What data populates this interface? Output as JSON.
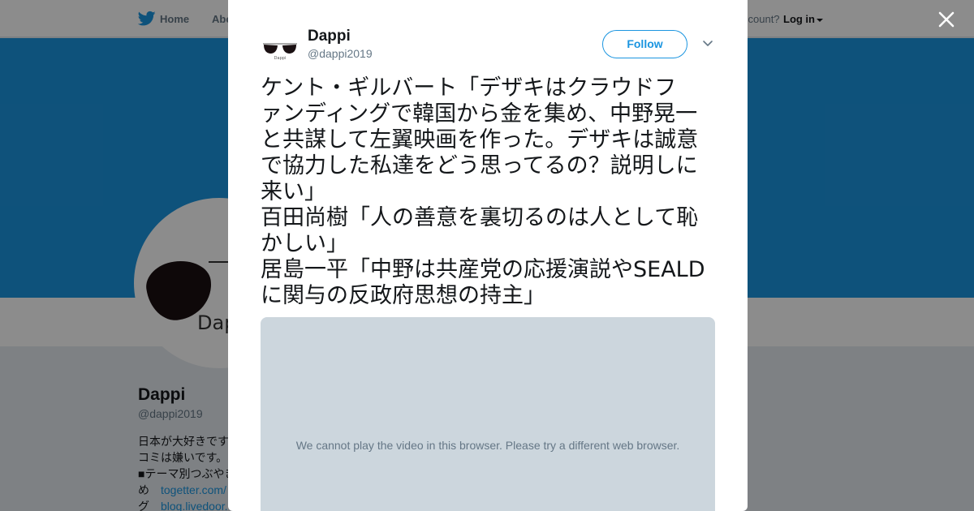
{
  "background_page": {
    "nav": {
      "home_label": "Home",
      "about_label": "Abo",
      "account_text": "ccount?",
      "login_label": "Log in"
    },
    "profile": {
      "avatar_text": "Dap",
      "name": "Dappi",
      "handle": "@dappi2019",
      "bio_lines": [
        {
          "prefix": "日本が大好きです",
          "link": ""
        },
        {
          "prefix": "コミは嫌いです。",
          "link": ""
        },
        {
          "prefix": "■テーマ別つぶやき",
          "link": ""
        },
        {
          "prefix": "め",
          "link": "togetter.com/"
        },
        {
          "prefix": "グ",
          "link": "blog.livedoor."
        }
      ]
    }
  },
  "modal": {
    "author": {
      "name": "Dappi",
      "handle": "@dappi2019",
      "avatar_text": "Dappi"
    },
    "follow_label": "Follow",
    "tweet_lines": [
      "ケント・ギルバート「デザキはクラウドフ",
      "ァンディングで韓国から金を集め、中野晃一",
      "と共謀して左翼映画を作った。デザキは誠意",
      "で協力した私達をどう思ってるの？説明しに",
      "来い」",
      "百田尚樹「人の善意を裏切るのは人として恥",
      "かしい」",
      "居島一平「中野は共産党の応援演説やSEALD",
      "に関与の反政府思想の持主」"
    ],
    "video_message": "We cannot play the video in this browser. Please try a different web browser."
  },
  "icons": {
    "nav_logo": "twitter-bird-icon",
    "close": "close-icon",
    "menu": "chevron-down-icon"
  },
  "colors": {
    "accent": "#1b95e0",
    "text": "#14171a",
    "muted": "#657786",
    "video_bg": "#ccd6dd"
  }
}
